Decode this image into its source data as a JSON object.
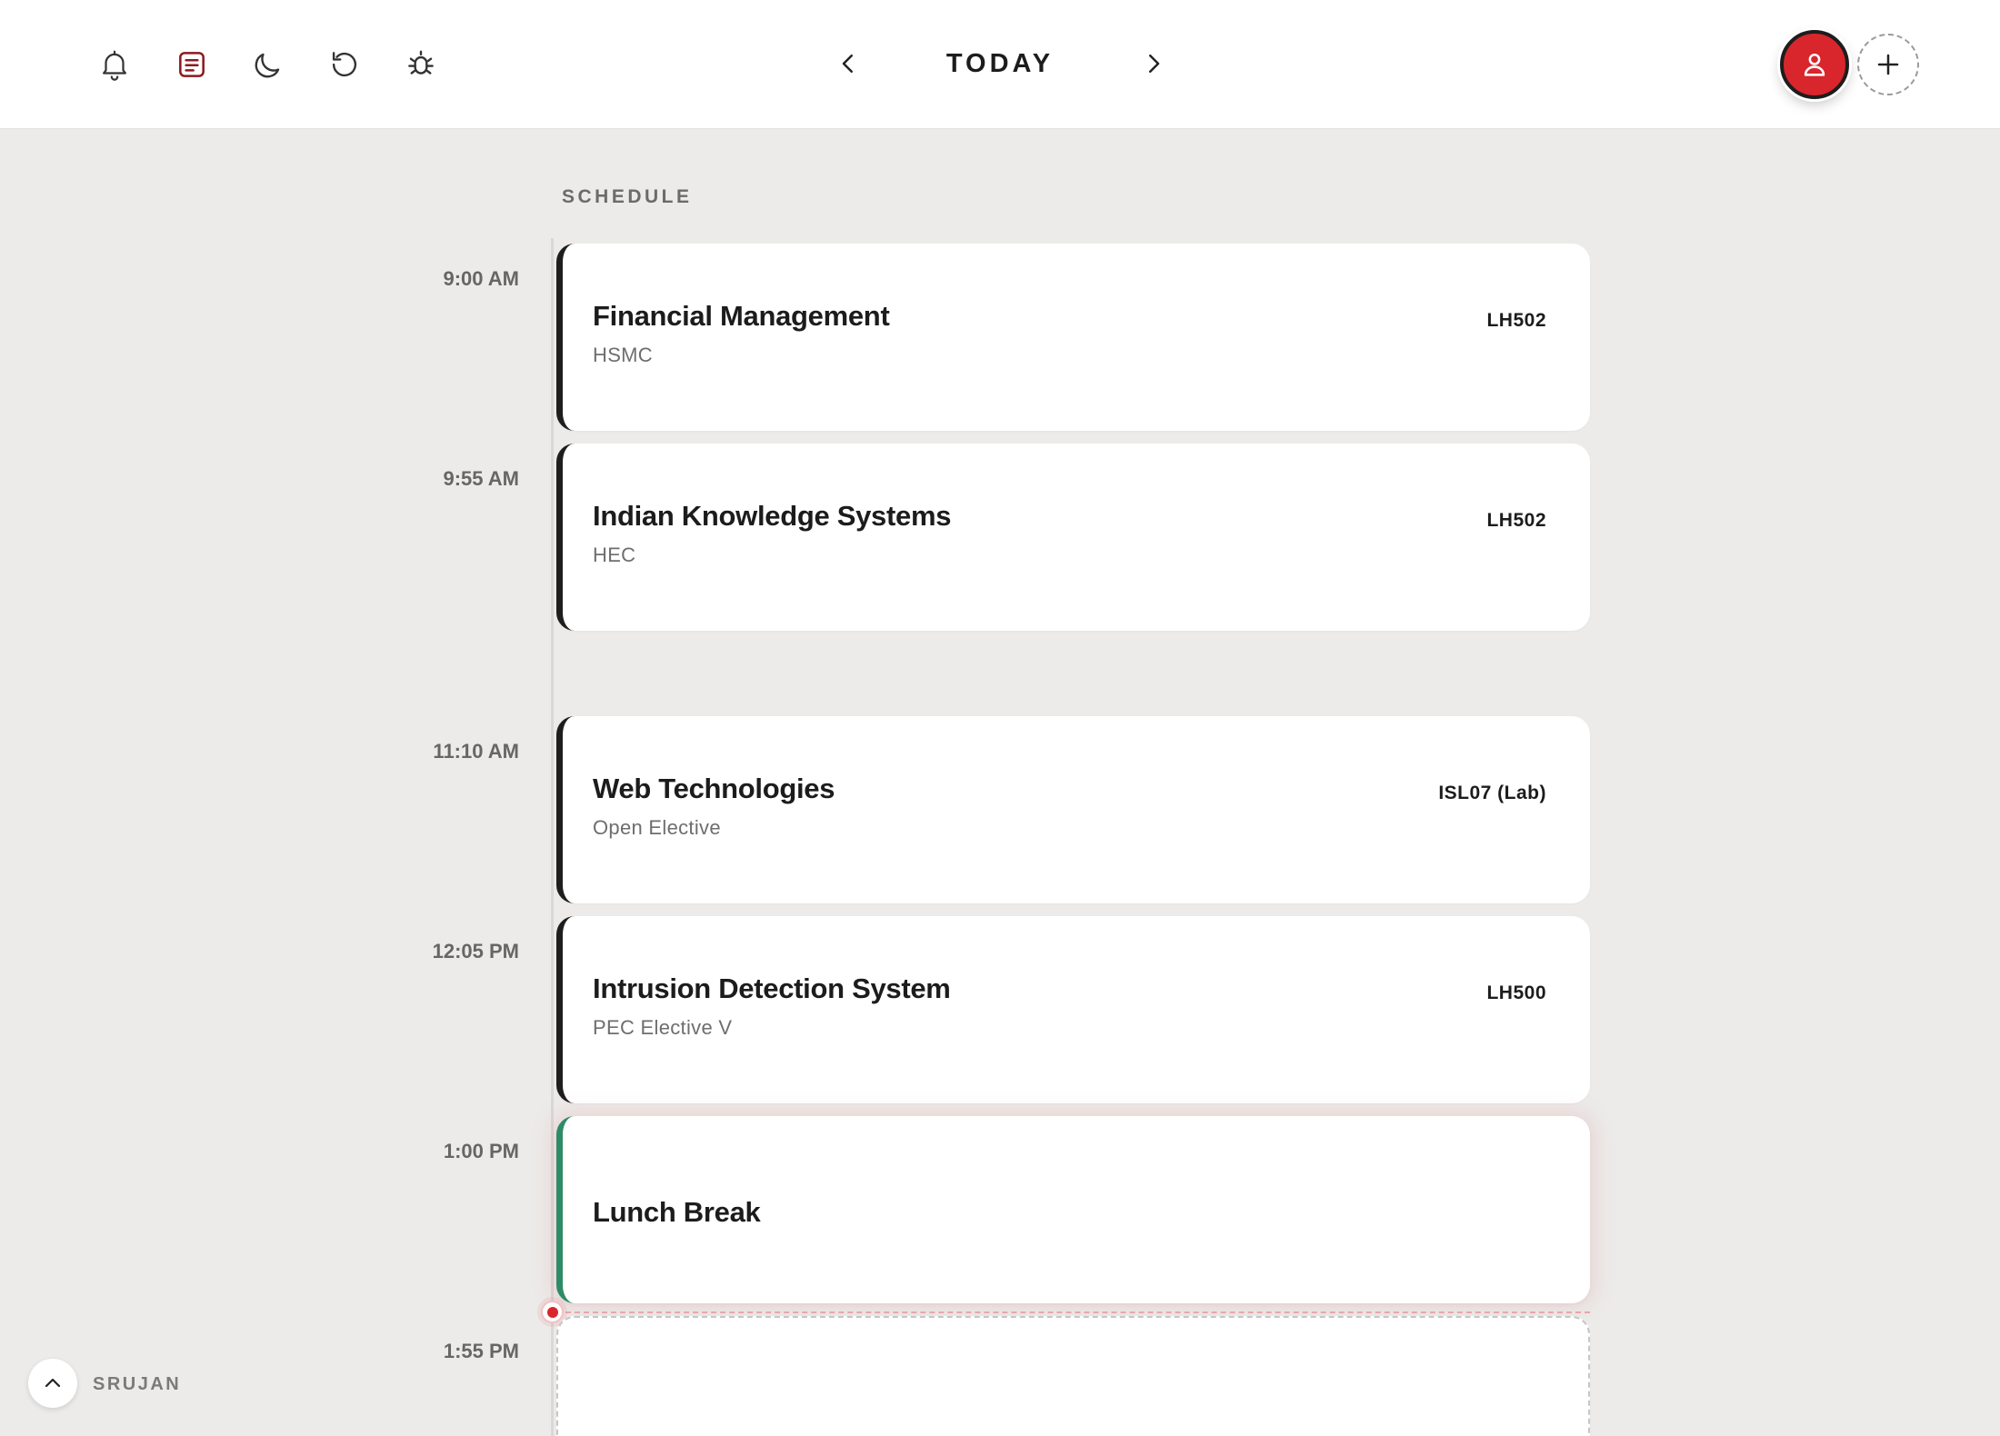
{
  "toolbar": {
    "icons": [
      "bell-icon",
      "notes-icon",
      "moon-icon",
      "refresh-icon",
      "bug-icon"
    ],
    "notes_icon_color": "#8b1a1f"
  },
  "nav": {
    "prev_icon": "chevron-left-icon",
    "title": "TODAY",
    "next_icon": "chevron-right-icon"
  },
  "account": {
    "avatar_icon": "user-icon",
    "avatar_color": "#d8262c",
    "add_icon": "plus-icon"
  },
  "schedule": {
    "label": "SCHEDULE",
    "items": [
      {
        "time": "9:00 AM",
        "title": "Financial Management",
        "subtitle": "HSMC",
        "room": "LH502"
      },
      {
        "time": "9:55 AM",
        "title": "Indian Knowledge Systems",
        "subtitle": "HEC",
        "room": "LH502"
      },
      {
        "time": "11:10 AM",
        "title": "Web Technologies",
        "subtitle": "Open Elective",
        "room": "ISL07 (Lab)"
      },
      {
        "time": "12:05 PM",
        "title": "Intrusion Detection System",
        "subtitle": "PEC Elective V",
        "room": "LH500"
      },
      {
        "time": "1:00 PM",
        "title": "Lunch Break",
        "subtitle": "",
        "room": ""
      },
      {
        "time": "1:55 PM",
        "title": "",
        "subtitle": "",
        "room": ""
      }
    ],
    "lunch_accent": "#2e8b67",
    "class_accent": "#1e1e1e",
    "now_indicator_color": "#d8262c"
  },
  "footer": {
    "collapse_icon": "chevron-up-icon",
    "user_name": "SRUJAN"
  }
}
